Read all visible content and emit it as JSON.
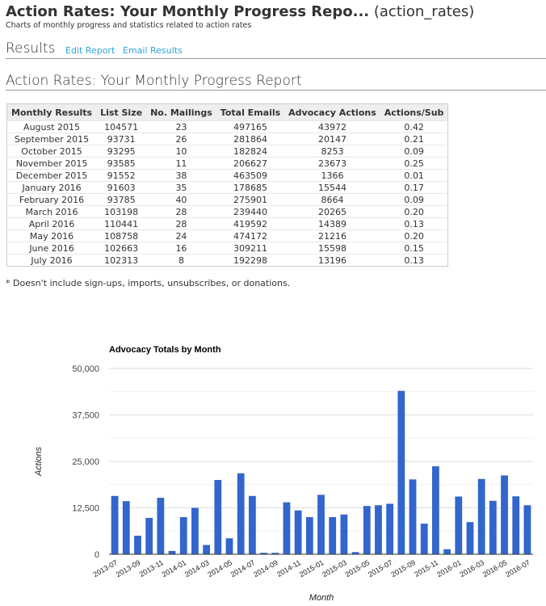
{
  "header": {
    "title_bold": "Action Rates: Your Monthly Progress Repo...",
    "title_id": "(action_rates)",
    "subtitle": "Charts of monthly progress and statistics related to action rates"
  },
  "results": {
    "label": "Results",
    "edit_report": "Edit Report",
    "email_results": "Email Results"
  },
  "report_title": "Action Rates: Your Monthly Progress Report",
  "table": {
    "columns": [
      "Monthly Results",
      "List Size",
      "No. Mailings",
      "Total Emails",
      "Advocacy Actions",
      "Actions/Sub"
    ],
    "rows": [
      [
        "August 2015",
        "104571",
        "23",
        "497165",
        "43972",
        "0.42"
      ],
      [
        "September 2015",
        "93731",
        "26",
        "281864",
        "20147",
        "0.21"
      ],
      [
        "October 2015",
        "93295",
        "10",
        "182824",
        "8253",
        "0.09"
      ],
      [
        "November 2015",
        "93585",
        "11",
        "206627",
        "23673",
        "0.25"
      ],
      [
        "December 2015",
        "91552",
        "38",
        "463509",
        "1366",
        "0.01"
      ],
      [
        "January 2016",
        "91603",
        "35",
        "178685",
        "15544",
        "0.17"
      ],
      [
        "February 2016",
        "93785",
        "40",
        "275901",
        "8664",
        "0.09"
      ],
      [
        "March 2016",
        "103198",
        "28",
        "239440",
        "20265",
        "0.20"
      ],
      [
        "April 2016",
        "110441",
        "28",
        "419592",
        "14389",
        "0.13"
      ],
      [
        "May 2016",
        "108758",
        "24",
        "474172",
        "21216",
        "0.20"
      ],
      [
        "June 2016",
        "102663",
        "16",
        "309211",
        "15598",
        "0.15"
      ],
      [
        "July 2016",
        "102313",
        "8",
        "192298",
        "13196",
        "0.13"
      ]
    ]
  },
  "note": "* Doesn't include sign-ups, imports, unsubscribes, or donations.",
  "chart_data": {
    "type": "bar",
    "title": "Advocacy Totals by Month",
    "xlabel": "Month",
    "ylabel": "Actions",
    "ylim": [
      0,
      50000
    ],
    "yticks": [
      "0",
      "12,500",
      "25,000",
      "37,500",
      "50,000"
    ],
    "color": "#3366cc",
    "grid": true,
    "categories": [
      "2013-07",
      "2013-08",
      "2013-09",
      "2013-10",
      "2013-11",
      "2013-12",
      "2014-01",
      "2014-02",
      "2014-03",
      "2014-04",
      "2014-05",
      "2014-06",
      "2014-07",
      "2014-08",
      "2014-09",
      "2014-10",
      "2014-11",
      "2014-12",
      "2015-01",
      "2015-02",
      "2015-03",
      "2015-04",
      "2015-05",
      "2015-06",
      "2015-07",
      "2015-08",
      "2015-09",
      "2015-10",
      "2015-11",
      "2015-12",
      "2016-01",
      "2016-02",
      "2016-03",
      "2016-04",
      "2016-05",
      "2016-06",
      "2016-07"
    ],
    "values": [
      15700,
      14300,
      5000,
      9800,
      15200,
      900,
      10000,
      12500,
      2500,
      20000,
      4300,
      21800,
      15700,
      400,
      400,
      14000,
      11800,
      10000,
      16000,
      10000,
      10700,
      600,
      13000,
      13200,
      13600,
      43972,
      20147,
      8253,
      23673,
      1366,
      15544,
      8664,
      20265,
      14389,
      21216,
      15598,
      13196
    ]
  }
}
